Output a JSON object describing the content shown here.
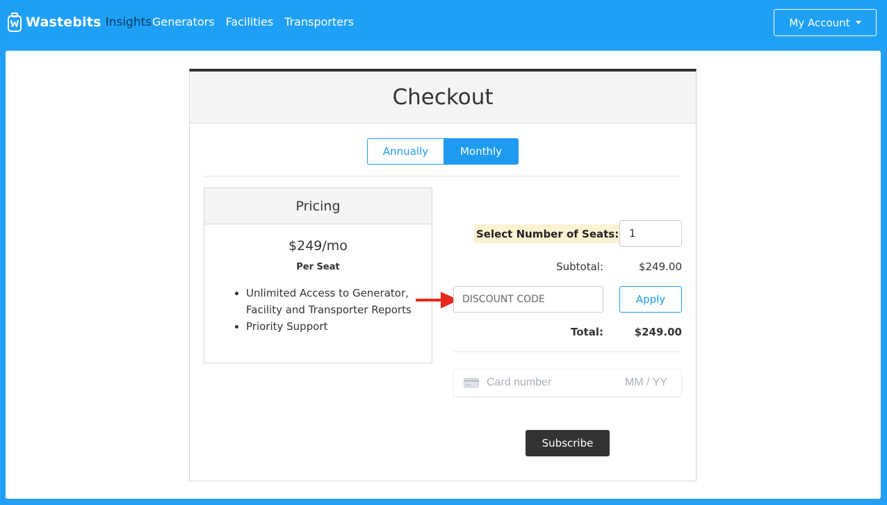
{
  "navbar": {
    "brand_name": "Wastebits",
    "brand_sub": "Insights",
    "links": [
      "Generators",
      "Facilities",
      "Transporters"
    ],
    "account_label": "My Account"
  },
  "checkout": {
    "title": "Checkout",
    "billing_toggle": {
      "options": [
        "Annually",
        "Monthly"
      ],
      "selected": "Monthly"
    },
    "pricing": {
      "heading": "Pricing",
      "price": "$249/mo",
      "per_seat": "Per Seat",
      "features": [
        "Unlimited Access to Generator, Facility and Transporter Reports",
        "Priority Support"
      ]
    },
    "seats": {
      "label": "Select Number of Seats:",
      "value": "1"
    },
    "subtotal": {
      "label": "Subtotal:",
      "value": "$249.00"
    },
    "discount": {
      "placeholder": "DISCOUNT CODE",
      "apply_label": "Apply"
    },
    "total": {
      "label": "Total:",
      "value": "$249.00"
    },
    "card": {
      "number_placeholder": "Card number",
      "expiry_placeholder": "MM / YY"
    },
    "subscribe_label": "Subscribe"
  },
  "colors": {
    "brand_blue": "#1fa0f7",
    "accent": "#1e9bf0",
    "annotation_arrow": "#e8281c",
    "dark_button": "#333333"
  },
  "icons": [
    "wastebits-logo-icon",
    "caret-down-icon",
    "red-arrow-icon",
    "credit-card-icon"
  ]
}
